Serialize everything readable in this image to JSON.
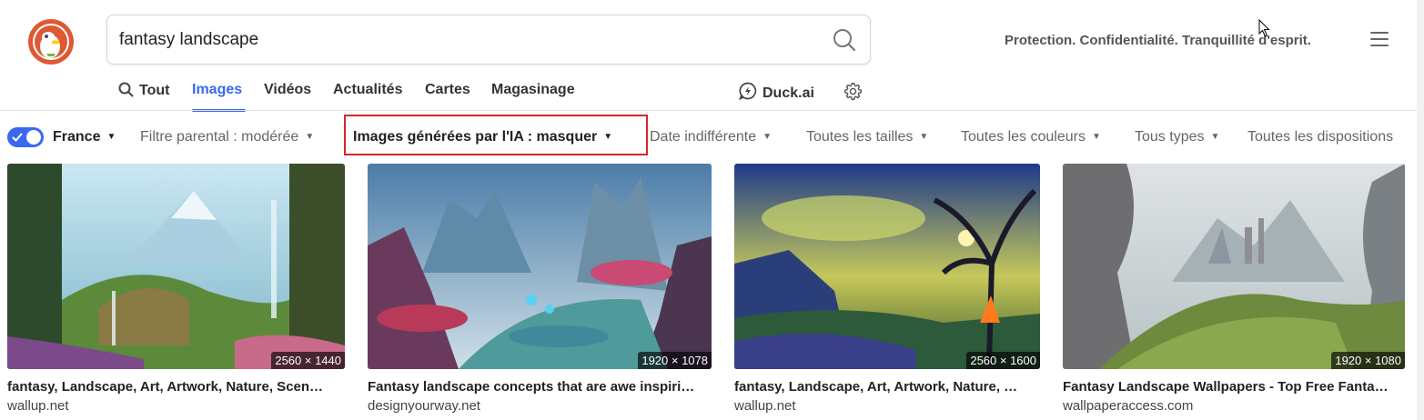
{
  "search": {
    "query": "fantasy landscape"
  },
  "header": {
    "tagline": "Protection. Confidentialité. Tranquillité d'esprit."
  },
  "tabs": [
    {
      "label": "Tout",
      "active": false
    },
    {
      "label": "Images",
      "active": true
    },
    {
      "label": "Vidéos",
      "active": false
    },
    {
      "label": "Actualités",
      "active": false
    },
    {
      "label": "Cartes",
      "active": false
    },
    {
      "label": "Magasinage",
      "active": false
    },
    {
      "label": "Duck.ai",
      "active": false
    }
  ],
  "filters": {
    "region_enabled": true,
    "region": "France",
    "safe_search": "Filtre parental : modérée",
    "ai_images": "Images générées par l'IA : masquer",
    "date": "Date indifférente",
    "size": "Toutes les tailles",
    "color": "Toutes les couleurs",
    "type": "Tous types",
    "layout": "Toutes les dispositions"
  },
  "results": [
    {
      "title": "fantasy, Landscape, Art, Artwork, Nature, Scen…",
      "source": "wallup.net",
      "dimensions": "2560 × 1440"
    },
    {
      "title": "Fantasy landscape concepts that are awe inspiri…",
      "source": "designyourway.net",
      "dimensions": "1920 × 1078"
    },
    {
      "title": "fantasy, Landscape, Art, Artwork, Nature, …",
      "source": "wallup.net",
      "dimensions": "2560 × 1600"
    },
    {
      "title": "Fantasy Landscape Wallpapers - Top Free Fanta…",
      "source": "wallpaperaccess.com",
      "dimensions": "1920 × 1080"
    }
  ],
  "colors": {
    "accent": "#3969ef",
    "highlight": "#d9262c",
    "brand": "#de5833"
  },
  "icons": [
    "duckduckgo-logo",
    "search-icon",
    "menu-icon",
    "duck-ai-icon",
    "gear-icon",
    "checkmark-icon",
    "caret-down-icon"
  ]
}
